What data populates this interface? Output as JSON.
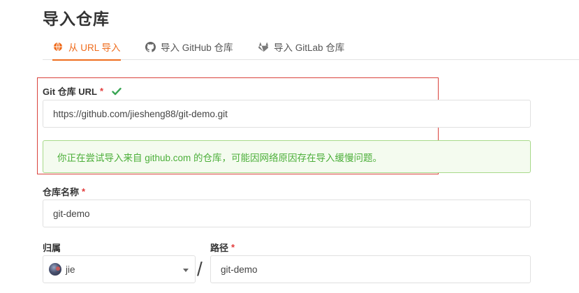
{
  "page": {
    "title": "导入仓库"
  },
  "tabs": [
    {
      "label": "从 URL 导入",
      "icon": "globe-icon",
      "active": true
    },
    {
      "label": "导入 GitHub 仓库",
      "icon": "github-icon",
      "active": false
    },
    {
      "label": "导入 GitLab 仓库",
      "icon": "gitlab-icon",
      "active": false
    }
  ],
  "form": {
    "git_url": {
      "label": "Git 仓库 URL",
      "required_mark": "*",
      "value": "https://github.com/jiesheng88/git-demo.git",
      "valid": true
    },
    "notice": "你正在尝试导入来自 github.com 的仓库，可能因网络原因存在导入缓慢问题。",
    "repo_name": {
      "label": "仓库名称",
      "required_mark": "*",
      "value": "git-demo"
    },
    "owner": {
      "label": "归属",
      "value": "jie"
    },
    "separator": "/",
    "path": {
      "label": "路径",
      "required_mark": "*",
      "value": "git-demo"
    }
  },
  "colors": {
    "accent": "#ef6d1e",
    "success": "#4caf3a",
    "required": "#e23b3b",
    "highlight_box": "#d9423c"
  }
}
